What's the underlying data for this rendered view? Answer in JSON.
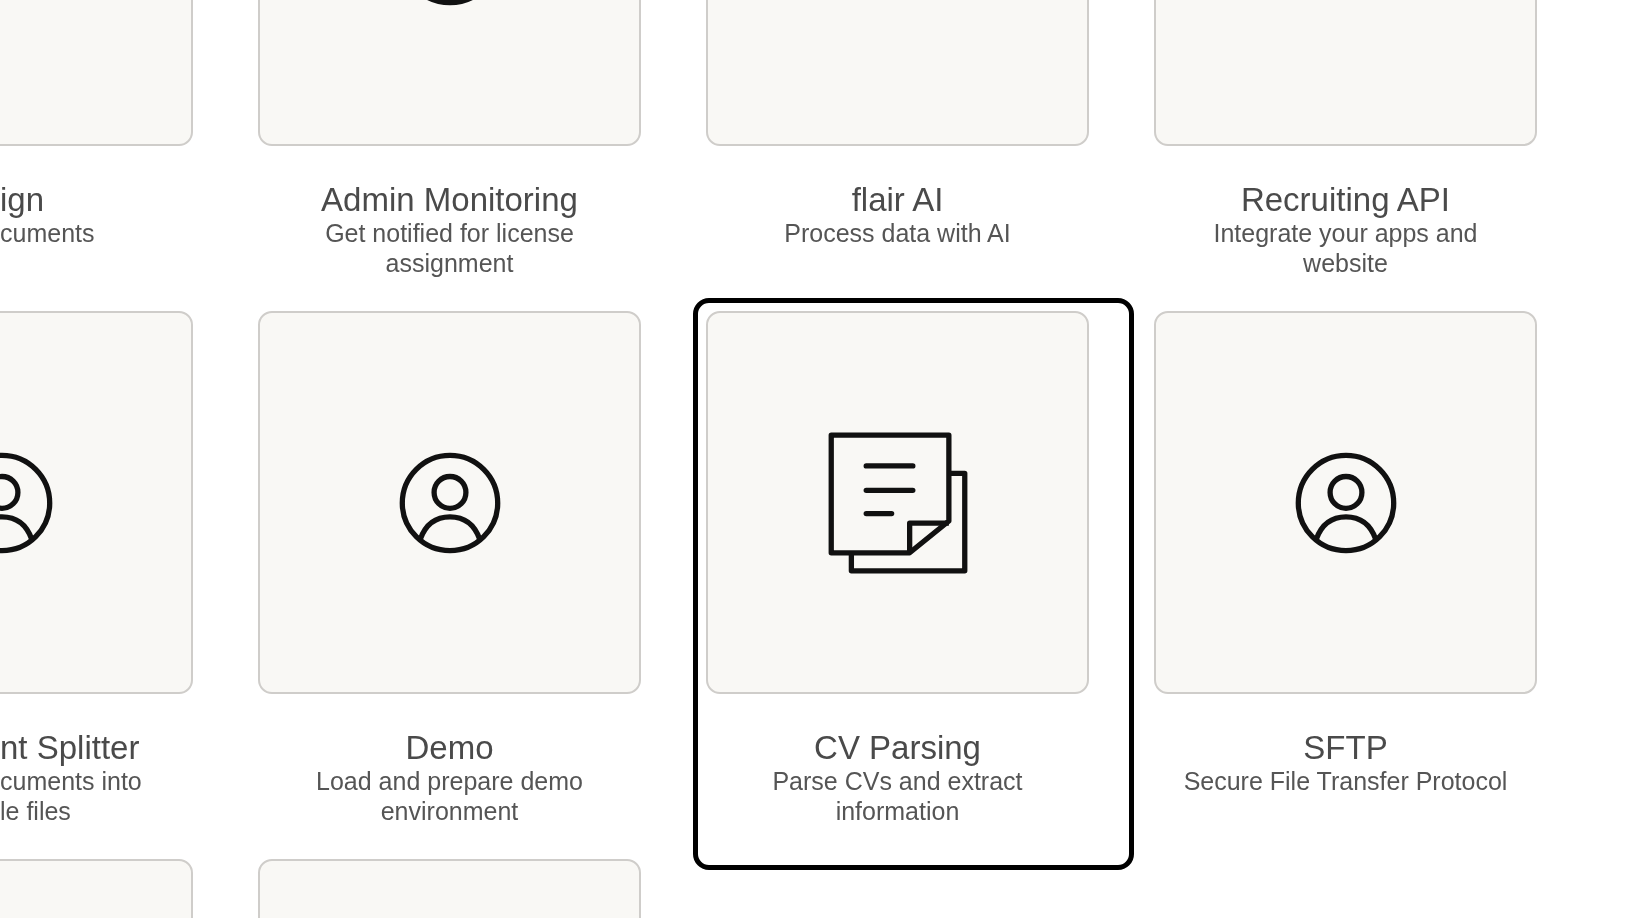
{
  "card_rows": [
    {
      "cards": [
        {
          "title": "ign",
          "description": "cuments",
          "selected": false
        },
        {
          "title": "Admin Monitoring",
          "description": "Get notified for license assignment",
          "kind": "person",
          "selected": false
        },
        {
          "title": "flair AI",
          "description": "Process data with AI",
          "selected": false
        },
        {
          "title": "Recruiting API",
          "description": "Integrate your apps and website",
          "selected": false
        }
      ]
    },
    {
      "cards": [
        {
          "title": "nt Splitter",
          "description": "cuments into\nle files",
          "kind": "person",
          "selected": false
        },
        {
          "title": "Demo",
          "description": "Load and prepare demo environment",
          "kind": "person",
          "selected": false
        },
        {
          "title": "CV Parsing",
          "description": "Parse CVs and extract information",
          "kind": "documents",
          "selected": true
        },
        {
          "title": "SFTP",
          "description": "Secure File Transfer Protocol",
          "kind": "person",
          "selected": false
        }
      ]
    },
    {
      "cards": [
        {
          "selected": false
        },
        {
          "selected": false
        }
      ]
    }
  ]
}
